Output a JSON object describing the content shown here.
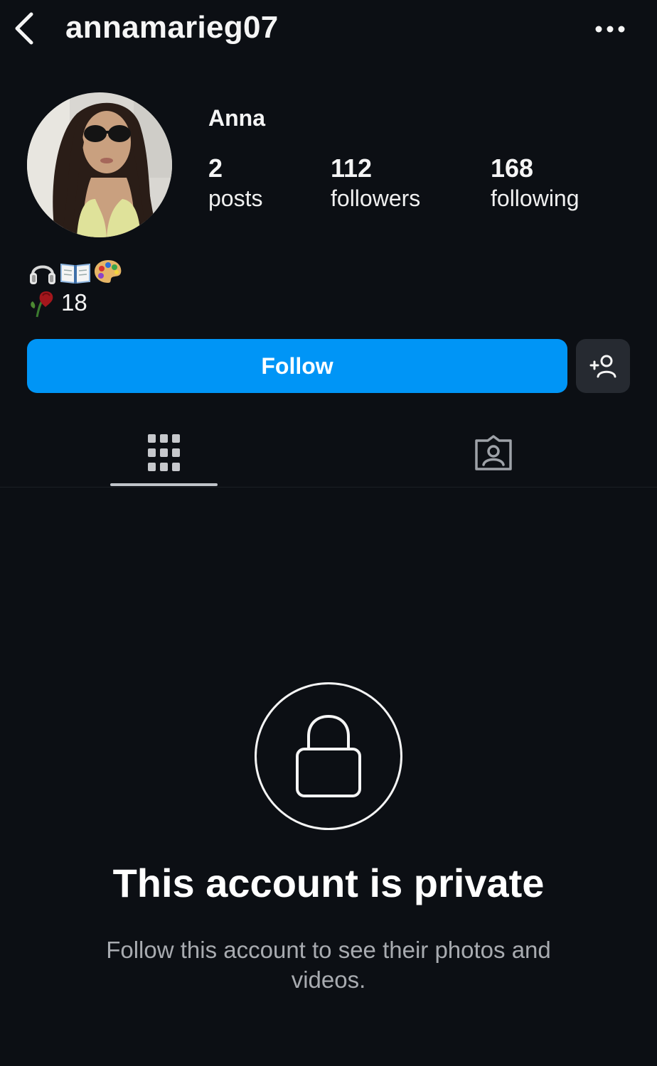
{
  "header": {
    "username": "annamarieg07",
    "back_icon": "chevron-left-icon",
    "more_icon": "more-horizontal-icon"
  },
  "profile": {
    "display_name": "Anna",
    "stats": [
      {
        "value": "2",
        "label": "posts"
      },
      {
        "value": "112",
        "label": "followers"
      },
      {
        "value": "168",
        "label": "following"
      }
    ],
    "bio_line1_emojis": [
      "headphones",
      "open-book",
      "artist-palette"
    ],
    "bio_line2_emoji": "wilted-rose",
    "bio_age": "18"
  },
  "actions": {
    "follow_label": "Follow",
    "follow_color": "#0095f6",
    "suggest_icon": "add-person-icon"
  },
  "tabs": [
    {
      "icon": "grid-icon",
      "active": true
    },
    {
      "icon": "tagged-icon",
      "active": false
    }
  ],
  "private_notice": {
    "icon": "lock-icon",
    "title": "This account is private",
    "subtitle": "Follow this account to see their photos and videos."
  }
}
